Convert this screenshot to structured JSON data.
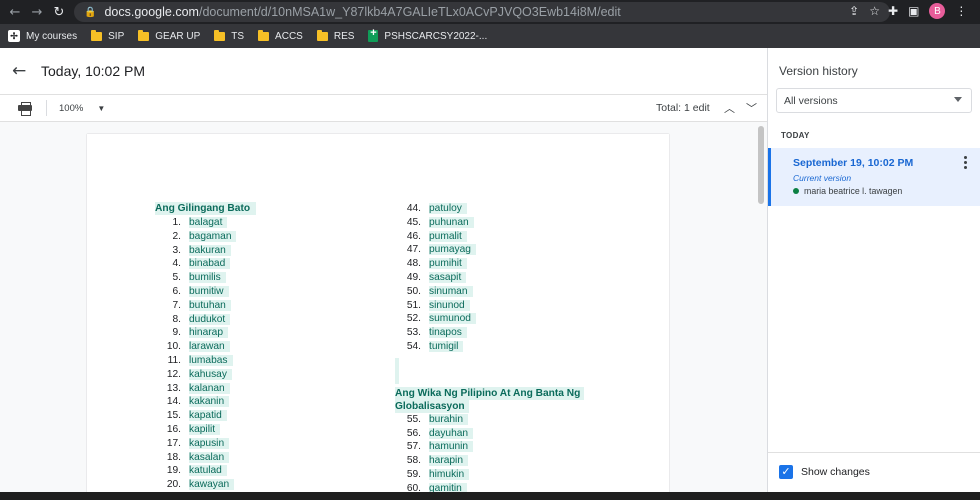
{
  "browser": {
    "url_host": "docs.google.com",
    "url_path": "/document/d/10nMSA1w_Y87lkb4A7GALIeTLx0ACvPJVQO3Ewb14i8M/edit",
    "profile_initial": "B",
    "bookmarks": [
      {
        "label": "My courses",
        "icon": "course-icon"
      },
      {
        "label": "SIP",
        "icon": "folder-icon"
      },
      {
        "label": "GEAR UP",
        "icon": "folder-icon"
      },
      {
        "label": "TS",
        "icon": "folder-icon"
      },
      {
        "label": "ACCS",
        "icon": "folder-icon"
      },
      {
        "label": "RES",
        "icon": "folder-icon"
      },
      {
        "label": "PSHSCARCSY2022-...",
        "icon": "sheets-icon"
      }
    ]
  },
  "header": {
    "title": "Today, 10:02 PM"
  },
  "toolbar": {
    "zoom": "100%",
    "total_edits": "Total: 1 edit"
  },
  "document": {
    "left_heading": "Ang Gilingang Bato",
    "left_items": [
      {
        "n": "1.",
        "w": "balagat"
      },
      {
        "n": "2.",
        "w": "bagaman"
      },
      {
        "n": "3.",
        "w": "bakuran"
      },
      {
        "n": "4.",
        "w": "binabad"
      },
      {
        "n": "5.",
        "w": "bumilis"
      },
      {
        "n": "6.",
        "w": "bumitiw"
      },
      {
        "n": "7.",
        "w": "butuhan"
      },
      {
        "n": "8.",
        "w": "dudukot"
      },
      {
        "n": "9.",
        "w": "hinarap"
      },
      {
        "n": "10.",
        "w": "larawan"
      },
      {
        "n": "11.",
        "w": "lumabas"
      },
      {
        "n": "12.",
        "w": "kahusay"
      },
      {
        "n": "13.",
        "w": "kalanan"
      },
      {
        "n": "14.",
        "w": "kakanin"
      },
      {
        "n": "15.",
        "w": "kapatid"
      },
      {
        "n": "16.",
        "w": "kapilit"
      },
      {
        "n": "17.",
        "w": "kapusin"
      },
      {
        "n": "18.",
        "w": "kasalan"
      },
      {
        "n": "19.",
        "w": "katulad"
      },
      {
        "n": "20.",
        "w": "kawayan"
      }
    ],
    "right_items_top": [
      {
        "n": "44.",
        "w": "patuloy"
      },
      {
        "n": "45.",
        "w": "puhunan"
      },
      {
        "n": "46.",
        "w": "pumalit"
      },
      {
        "n": "47.",
        "w": "pumayag"
      },
      {
        "n": "48.",
        "w": "pumihit"
      },
      {
        "n": "49.",
        "w": "sasapit"
      },
      {
        "n": "50.",
        "w": "sinuman"
      },
      {
        "n": "51.",
        "w": "sinunod"
      },
      {
        "n": "52.",
        "w": "sumunod"
      },
      {
        "n": "53.",
        "w": "tinapos"
      },
      {
        "n": "54.",
        "w": "tumigil"
      }
    ],
    "right_heading_line1": "Ang Wika Ng Pilipino At Ang Banta Ng",
    "right_heading_line2": "Globalisasyon",
    "right_items_bottom": [
      {
        "n": "55.",
        "w": "burahin"
      },
      {
        "n": "56.",
        "w": "dayuhan"
      },
      {
        "n": "57.",
        "w": "hamunin"
      },
      {
        "n": "58.",
        "w": "harapin"
      },
      {
        "n": "59.",
        "w": "himukin"
      },
      {
        "n": "60.",
        "w": "gamitin"
      }
    ]
  },
  "sidebar": {
    "title": "Version history",
    "filter": "All versions",
    "section": "TODAY",
    "version": {
      "date": "September 19, 10:02 PM",
      "status": "Current version",
      "author": "maria beatrice l. tawagen",
      "author_color": "#0b8043"
    },
    "show_changes": "Show changes"
  }
}
